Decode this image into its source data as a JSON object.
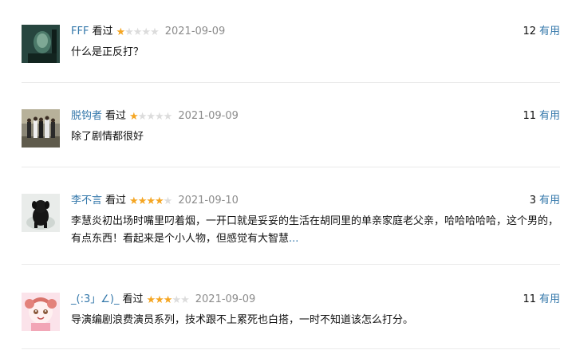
{
  "comments": [
    {
      "user": "FFF",
      "status": "看过",
      "rating": 1,
      "date": "2021-09-09",
      "useful_count": "12",
      "useful_label": "有用",
      "content": "什么是正反打？"
    },
    {
      "user": "脱钩者",
      "status": "看过",
      "rating": 1,
      "date": "2021-09-09",
      "useful_count": "11",
      "useful_label": "有用",
      "content": "除了剧情都很好"
    },
    {
      "user": "李不言",
      "status": "看过",
      "rating": 4,
      "date": "2021-09-10",
      "useful_count": "3",
      "useful_label": "有用",
      "content": "李慧炎初出场时嘴里叼着烟，一开口就是妥妥的生活在胡同里的单亲家庭老父亲，哈哈哈哈哈，这个男的，有点东西！看起来是个小人物，但感觉有大智慧",
      "more": "..."
    },
    {
      "user": "_(:3」∠)_",
      "status": "看过",
      "rating": 3,
      "date": "2021-09-09",
      "useful_count": "11",
      "useful_label": "有用",
      "content": "导演编剧浪费演员系列，技术跟不上累死也白搭，一时不知道该怎么打分。"
    }
  ],
  "colors": {
    "link": "#3377aa",
    "star_on": "#f5a623",
    "star_off": "#dcdcdc",
    "date": "#8c8c8c",
    "divider": "#eaeaea"
  }
}
